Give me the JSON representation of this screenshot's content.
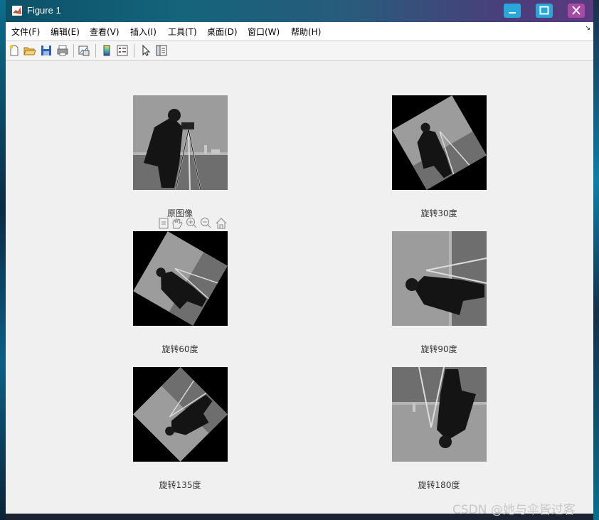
{
  "window": {
    "title": "Figure 1"
  },
  "menu": {
    "items": [
      "文件(F)",
      "编辑(E)",
      "查看(V)",
      "插入(I)",
      "工具(T)",
      "桌面(D)",
      "窗口(W)",
      "帮助(H)"
    ]
  },
  "subplots": [
    {
      "caption": "原图像",
      "rotation_deg": 0
    },
    {
      "caption": "旋转30度",
      "rotation_deg": 30
    },
    {
      "caption": "旋转60度",
      "rotation_deg": 60
    },
    {
      "caption": "旋转90度",
      "rotation_deg": 90
    },
    {
      "caption": "旋转135度",
      "rotation_deg": 135
    },
    {
      "caption": "旋转180度",
      "rotation_deg": 180
    }
  ],
  "watermark": "CSDN @她与伞皆过客",
  "icons": [
    "matlab-icon",
    "minimize-icon",
    "maximize-icon",
    "close-icon",
    "new-figure-icon",
    "open-file-icon",
    "save-icon",
    "print-icon",
    "link-plot-icon",
    "insert-colorbar-icon",
    "insert-legend-icon",
    "edit-plot-icon",
    "property-inspector-icon",
    "export-icon",
    "pan-icon",
    "zoom-in-icon",
    "zoom-out-icon",
    "home-icon"
  ],
  "colors": {
    "titlebar_start": "#0d5168",
    "titlebar_end": "#5a3a80",
    "close_button": "#a74aa6",
    "window_buttons": "#29a7d8",
    "figure_bg": "#f0f0f0"
  }
}
